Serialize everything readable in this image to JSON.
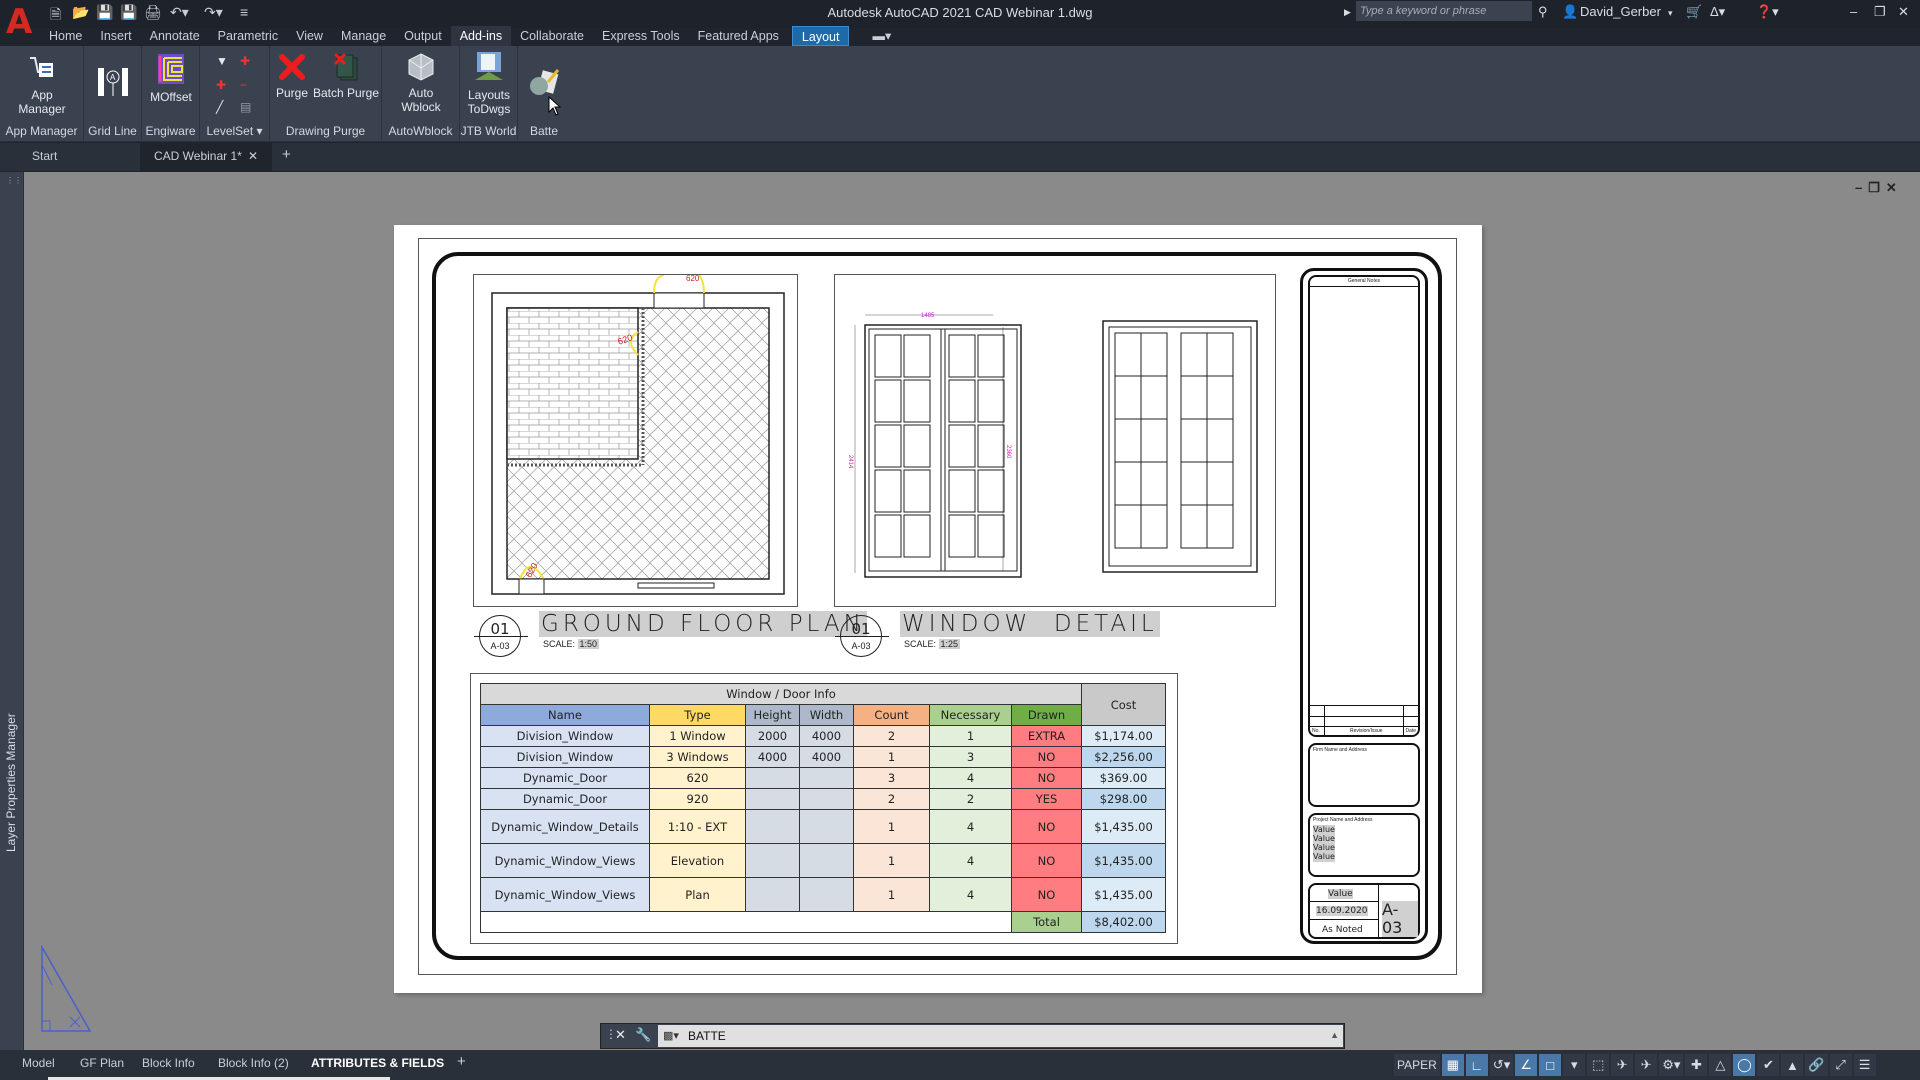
{
  "app": {
    "title": "Autodesk AutoCAD 2021    CAD Webinar 1.dwg",
    "logo": "A",
    "search_placeholder": "Type a keyword or phrase",
    "user": "David_Gerber",
    "quick_access": [
      "new",
      "open",
      "save",
      "save-as",
      "plot",
      "undo",
      "redo",
      "customize"
    ]
  },
  "ribbon_tabs": [
    {
      "label": "Home"
    },
    {
      "label": "Insert"
    },
    {
      "label": "Annotate"
    },
    {
      "label": "Parametric"
    },
    {
      "label": "View"
    },
    {
      "label": "Manage"
    },
    {
      "label": "Output"
    },
    {
      "label": "Add-ins",
      "active": true
    },
    {
      "label": "Collaborate"
    },
    {
      "label": "Express Tools"
    },
    {
      "label": "Featured Apps"
    },
    {
      "label": "Layout",
      "contextual": true
    }
  ],
  "ribbon_panels": {
    "app_manager": {
      "button": "App Manager",
      "label": "App Manager"
    },
    "grid_line": {
      "label": "Grid Line"
    },
    "engiware": {
      "button": "MOffset",
      "label": "Engiware"
    },
    "levelset": {
      "label": "LevelSet"
    },
    "drawing_purge": {
      "purge": "Purge",
      "batch_purge": "Batch Purge",
      "label": "Drawing Purge"
    },
    "autowblock": {
      "button_line1": "Auto",
      "button_line2": "Wblock",
      "label": "AutoWblock"
    },
    "jtb_world": {
      "button_line1": "Layouts",
      "button_line2": "ToDwgs",
      "label": "JTB World"
    },
    "batte": {
      "label": "Batte"
    }
  },
  "doc_tabs": {
    "start": "Start",
    "active": "CAD Webinar 1*"
  },
  "left_palette": {
    "label": "Layer Properties Manager"
  },
  "drawing": {
    "plan_view": {
      "number": "01",
      "sheet": "A-03",
      "title": "GROUND FLOOR PLAN",
      "scale_label": "SCALE:",
      "scale": "1:50",
      "door_tags": [
        "620",
        "620",
        "620"
      ]
    },
    "window_view": {
      "number": "01",
      "sheet": "A-03",
      "title": "WINDOW  DETAIL",
      "scale_label": "SCALE:",
      "scale": "1:25",
      "dims": {
        "width": "1485",
        "height_left": "2414",
        "height_right": "2360"
      }
    }
  },
  "table": {
    "title": "Window / Door Info",
    "cost_header": "Cost",
    "columns": [
      "Name",
      "Type",
      "Height",
      "Width",
      "Count",
      "Necessary",
      "Drawn"
    ],
    "rows": [
      {
        "name": "Division_Window",
        "type": "1 Window",
        "height": "2000",
        "width": "4000",
        "count": "2",
        "necessary": "1",
        "drawn": "EXTRA",
        "cost": "$1,174.00"
      },
      {
        "name": "Division_Window",
        "type": "3 Windows",
        "height": "4000",
        "width": "4000",
        "count": "1",
        "necessary": "3",
        "drawn": "NO",
        "cost": "$2,256.00"
      },
      {
        "name": "Dynamic_Door",
        "type": "620",
        "height": "",
        "width": "",
        "count": "3",
        "necessary": "4",
        "drawn": "NO",
        "cost": "$369.00"
      },
      {
        "name": "Dynamic_Door",
        "type": "920",
        "height": "",
        "width": "",
        "count": "2",
        "necessary": "2",
        "drawn": "YES",
        "cost": "$298.00"
      },
      {
        "name": "Dynamic_Window_Details",
        "type": "1:10 - EXT",
        "height": "",
        "width": "",
        "count": "1",
        "necessary": "4",
        "drawn": "NO",
        "cost": "$1,435.00"
      },
      {
        "name": "Dynamic_Window_Views",
        "type": "Elevation",
        "height": "",
        "width": "",
        "count": "1",
        "necessary": "4",
        "drawn": "NO",
        "cost": "$1,435.00"
      },
      {
        "name": "Dynamic_Window_Views",
        "type": "Plan",
        "height": "",
        "width": "",
        "count": "1",
        "necessary": "4",
        "drawn": "NO",
        "cost": "$1,435.00"
      }
    ],
    "total_label": "Total",
    "total": "$8,402.00"
  },
  "title_block": {
    "general_notes": "General Notes",
    "rev_no": "No.",
    "rev_desc": "Revision/Issue",
    "rev_date": "Date",
    "firm_label": "Firm Name and Address",
    "project_label": "Project Name and Address",
    "project_values": [
      "Value",
      "Value",
      "Value",
      "Value"
    ],
    "project": "Value",
    "date": "16.09.2020",
    "scale": "As Noted",
    "sheet": "A-03"
  },
  "command_line": {
    "text": "BATTE"
  },
  "layout_tabs": [
    {
      "label": "Model"
    },
    {
      "label": "GF Plan"
    },
    {
      "label": "Block Info"
    },
    {
      "label": "Block Info (2)"
    },
    {
      "label": "ATTRIBUTES & FIELDS",
      "active": true
    }
  ],
  "status_bar": {
    "space": "PAPER"
  }
}
